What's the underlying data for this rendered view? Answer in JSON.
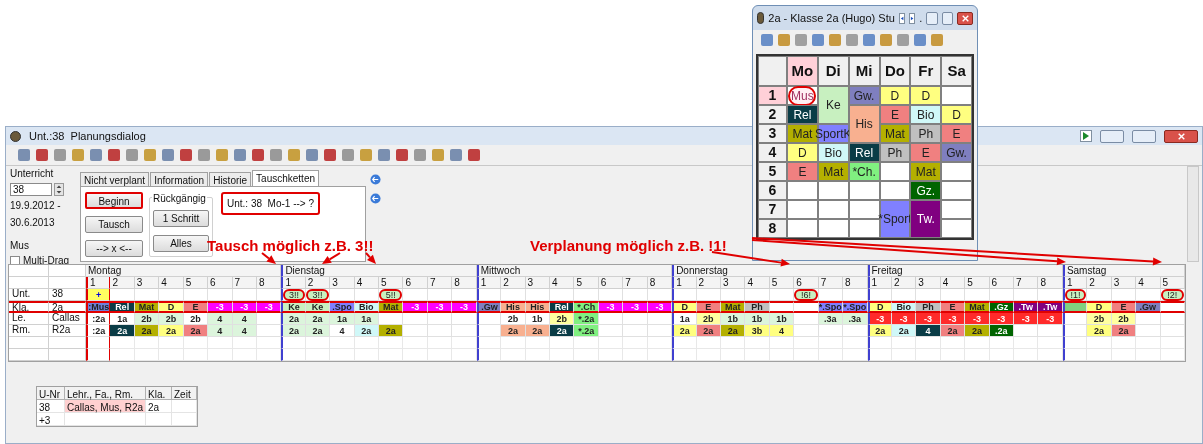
{
  "class_window": {
    "title": "2a - Klasse 2a (Hugo)  Stu",
    "title_tail": ".",
    "days": [
      {
        "label": "Mo",
        "selected": true
      },
      {
        "label": "Di",
        "selected": false
      },
      {
        "label": "Mi",
        "selected": false
      },
      {
        "label": "Do",
        "selected": false
      },
      {
        "label": "Fr",
        "selected": false
      },
      {
        "label": "Sa",
        "selected": false
      }
    ],
    "periods": [
      {
        "label": "1",
        "selected": true
      },
      {
        "label": "2",
        "selected": false
      },
      {
        "label": "3",
        "selected": false
      },
      {
        "label": "4",
        "selected": false
      },
      {
        "label": "5",
        "selected": false
      },
      {
        "label": "6",
        "selected": false
      },
      {
        "label": "7",
        "selected": false
      },
      {
        "label": "8",
        "selected": false
      }
    ],
    "columns": [
      [
        {
          "text": "Mus",
          "color": "#fff0f4",
          "circled": true
        },
        {
          "text": "Rel",
          "color": "#0a3c46"
        },
        {
          "text": "Mat",
          "color": "#b4b000"
        },
        {
          "text": "D",
          "color": "#ffff80"
        },
        {
          "text": "E",
          "color": "#f08080"
        },
        null,
        null,
        null
      ],
      [
        {
          "text": "Ke",
          "color": "#c8f0c0"
        },
        {
          "continued": true
        },
        {
          "text": "SportK",
          "color": "#8080ff"
        },
        {
          "text": "Bio",
          "color": "#d0f8f8"
        },
        {
          "text": "Mat",
          "color": "#b4b000"
        },
        null,
        null,
        null
      ],
      [
        {
          "text": "Gw.",
          "color": "#7f7fbf"
        },
        {
          "text": "His",
          "color": "#f8b090"
        },
        {
          "continued": true
        },
        {
          "text": "Rel",
          "color": "#0a3c46"
        },
        {
          "text": "*Ch.",
          "color": "#80f080"
        },
        null,
        null,
        null
      ],
      [
        {
          "text": "D",
          "color": "#ffff80"
        },
        {
          "text": "E",
          "color": "#f08080"
        },
        {
          "text": "Mat",
          "color": "#b4b000"
        },
        {
          "text": "Ph",
          "color": "#c0c0c0"
        },
        null,
        null,
        {
          "text": "*Sport",
          "color": "#8080ff"
        },
        {
          "continued": true
        }
      ],
      [
        {
          "text": "D",
          "color": "#ffff80"
        },
        {
          "text": "Bio",
          "color": "#d0f8f8"
        },
        {
          "text": "Ph",
          "color": "#c0c0c0"
        },
        {
          "text": "E",
          "color": "#f08080"
        },
        {
          "text": "Mat",
          "color": "#b4b000"
        },
        {
          "text": "Gz.",
          "color": "#006400"
        },
        {
          "text": "Tw.",
          "color": "#800080"
        },
        {
          "continued": true
        }
      ],
      [
        null,
        {
          "text": "D",
          "color": "#ffff80"
        },
        {
          "text": "E",
          "color": "#f08080"
        },
        {
          "text": "Gw.",
          "color": "#7f7fbf"
        },
        null,
        null,
        null,
        null
      ]
    ]
  },
  "window": {
    "title": "Unt.:38  Planungsdialog"
  },
  "left_panel": {
    "label": "Unterricht",
    "lesson_number": "38",
    "date_from": "19.9.2012 -",
    "date_to": "30.6.2013",
    "subject": "Mus",
    "multi_drag": {
      "label": "Multi-Drag",
      "checked": false
    }
  },
  "tabs": [
    {
      "label": "Nicht verplant",
      "selected": false
    },
    {
      "label": "Information",
      "selected": false
    },
    {
      "label": "Historie",
      "selected": false
    },
    {
      "label": "Tauschketten",
      "selected": true
    }
  ],
  "buttons": [
    {
      "label": "Beginn",
      "highlighted": true
    },
    {
      "label": "Tausch",
      "highlighted": false
    },
    {
      "label": "--> x <--",
      "highlighted": false
    }
  ],
  "undo_group": {
    "title": "Rückgängig",
    "buttons": [
      "1 Schritt",
      "Alles"
    ]
  },
  "chain_text": {
    "text": "Unt.: 38  Mo-1 --> ?",
    "highlighted": true
  },
  "annotations": [
    {
      "text": "Tausch möglich z.B. 3!!"
    },
    {
      "text": "Verplanung möglich z.B. !1!"
    }
  ],
  "plan": {
    "days": [
      {
        "name": "Montag",
        "periods": [
          {
            "label": "1",
            "selected": true
          },
          {
            "label": "2",
            "selected": false
          },
          {
            "label": "3",
            "selected": false
          },
          {
            "label": "4",
            "selected": false
          },
          {
            "label": "5",
            "selected": false
          },
          {
            "label": "6",
            "selected": false
          },
          {
            "label": "7",
            "selected": false
          },
          {
            "label": "8",
            "selected": false
          }
        ]
      },
      {
        "name": "Dienstag",
        "periods": [
          {
            "label": "1",
            "selected": false
          },
          {
            "label": "2",
            "selected": false
          },
          {
            "label": "3",
            "selected": false
          },
          {
            "label": "4",
            "selected": false
          },
          {
            "label": "5",
            "selected": false
          },
          {
            "label": "6",
            "selected": false
          },
          {
            "label": "7",
            "selected": false
          },
          {
            "label": "8",
            "selected": false
          }
        ]
      },
      {
        "name": "Mittwoch",
        "periods": [
          {
            "label": "1",
            "selected": false
          },
          {
            "label": "2",
            "selected": false
          },
          {
            "label": "3",
            "selected": false
          },
          {
            "label": "4",
            "selected": false
          },
          {
            "label": "5",
            "selected": false
          },
          {
            "label": "6",
            "selected": false
          },
          {
            "label": "7",
            "selected": false
          },
          {
            "label": "8",
            "selected": false
          }
        ]
      },
      {
        "name": "Donnerstag",
        "periods": [
          {
            "label": "1",
            "selected": false
          },
          {
            "label": "2",
            "selected": false
          },
          {
            "label": "3",
            "selected": false
          },
          {
            "label": "4",
            "selected": false
          },
          {
            "label": "5",
            "selected": false
          },
          {
            "label": "6",
            "selected": false
          },
          {
            "label": "7",
            "selected": false
          },
          {
            "label": "8",
            "selected": false
          }
        ]
      },
      {
        "name": "Freitag",
        "periods": [
          {
            "label": "1",
            "selected": false
          },
          {
            "label": "2",
            "selected": false
          },
          {
            "label": "3",
            "selected": false
          },
          {
            "label": "4",
            "selected": false
          },
          {
            "label": "5",
            "selected": false
          },
          {
            "label": "6",
            "selected": false
          },
          {
            "label": "7",
            "selected": false
          },
          {
            "label": "8",
            "selected": false
          }
        ]
      },
      {
        "name": "Samstag",
        "periods": [
          {
            "label": "1",
            "selected": false
          },
          {
            "label": "2",
            "selected": false
          },
          {
            "label": "3",
            "selected": false
          },
          {
            "label": "4",
            "selected": false
          },
          {
            "label": "5",
            "selected": false
          }
        ]
      }
    ],
    "rows": [
      {
        "head": "Unt.",
        "value": "38",
        "highlighted": false,
        "cells": [
          [
            {
              "text": "+",
              "color": "#ffff60",
              "circled": false
            },
            null,
            null,
            null,
            null,
            null,
            null,
            null
          ],
          [
            {
              "text": "3!!",
              "color": "#c8f0c0",
              "circled": true
            },
            {
              "text": "3!!",
              "color": "#c8f0c0",
              "circled": true
            },
            null,
            null,
            {
              "text": "5!!",
              "color": "#c8f0c0",
              "circled": true
            },
            null,
            null,
            null
          ],
          [
            null,
            null,
            null,
            null,
            null,
            null,
            null,
            null
          ],
          [
            null,
            null,
            null,
            null,
            null,
            {
              "text": "!6!",
              "color": "#c8f0c0",
              "circled": true
            },
            null,
            null
          ],
          [
            null,
            null,
            null,
            null,
            null,
            null,
            null,
            null
          ],
          [
            {
              "text": "!1!",
              "color": "#c8f0c0",
              "circled": true
            },
            null,
            null,
            null,
            {
              "text": "!2!",
              "color": "#c8f0c0",
              "circled": true
            }
          ]
        ]
      },
      {
        "head": "Kla.",
        "value": "2a",
        "highlighted": true,
        "cells": [
          [
            {
              "text": ":Mus",
              "color": "#6f80d8"
            },
            {
              "text": "Rel",
              "color": "#0a3c46"
            },
            {
              "text": "Mat",
              "color": "#b4b000"
            },
            {
              "text": "D",
              "color": "#ffff80"
            },
            {
              "text": "E",
              "color": "#f08080"
            },
            {
              "text": "-3",
              "color": "#ff00ff"
            },
            {
              "text": "-3",
              "color": "#ff00ff"
            },
            {
              "text": "-3",
              "color": "#ff00ff"
            }
          ],
          [
            {
              "text": "Ke",
              "color": "#c8f0c0"
            },
            {
              "text": "Ke",
              "color": "#c8f0c0"
            },
            {
              "text": ".Spo",
              "color": "#8080ff"
            },
            {
              "text": "Bio",
              "color": "#d0f8f8"
            },
            {
              "text": "Mat",
              "color": "#b4b000"
            },
            {
              "text": "-3",
              "color": "#ff00ff"
            },
            {
              "text": "-3",
              "color": "#ff00ff"
            },
            {
              "text": "-3",
              "color": "#ff00ff"
            }
          ],
          [
            {
              "text": ".Gw",
              "color": "#7f7fbf"
            },
            {
              "text": "His",
              "color": "#f8b090"
            },
            {
              "text": "His",
              "color": "#f8b090"
            },
            {
              "text": "Rel",
              "color": "#0a3c46"
            },
            {
              "text": "*.Ch",
              "color": "#80f080"
            },
            {
              "text": "-3",
              "color": "#ff00ff"
            },
            {
              "text": "-3",
              "color": "#ff00ff"
            },
            {
              "text": "-3",
              "color": "#ff00ff"
            }
          ],
          [
            {
              "text": "D",
              "color": "#ffff80"
            },
            {
              "text": "E",
              "color": "#f08080"
            },
            {
              "text": "Mat",
              "color": "#b4b000"
            },
            {
              "text": "Ph",
              "color": "#c0c0c0"
            },
            null,
            null,
            {
              "text": "*.Spo",
              "color": "#8080ff"
            },
            {
              "text": "*.Spo",
              "color": "#8080ff"
            }
          ],
          [
            {
              "text": "D",
              "color": "#ffff80"
            },
            {
              "text": "Bio",
              "color": "#d0f8f8"
            },
            {
              "text": "Ph",
              "color": "#c0c0c0"
            },
            {
              "text": "E",
              "color": "#f08080"
            },
            {
              "text": "Mat",
              "color": "#b4b000"
            },
            {
              "text": ".Gz",
              "color": "#006400"
            },
            {
              "text": ".Tw",
              "color": "#800080"
            },
            {
              "text": ".Tw",
              "color": "#800080"
            }
          ],
          [
            {
              "color": "#80d080"
            },
            {
              "text": "D",
              "color": "#ffff80"
            },
            {
              "text": "E",
              "color": "#f08080"
            },
            {
              "text": ".Gw",
              "color": "#7f7fbf"
            },
            null
          ]
        ]
      },
      {
        "head": "Le.",
        "value": "Callas",
        "highlighted": false,
        "cells": [
          [
            {
              "text": ":2a",
              "color": "#ffffff"
            },
            {
              "text": "1a",
              "color": "#ffffff"
            },
            {
              "text": "2b",
              "color": "#dcf5dc"
            },
            {
              "text": "2b",
              "color": "#dcf5dc"
            },
            {
              "text": "2b",
              "color": "#ffffff"
            },
            {
              "text": "4",
              "color": "#dcf5dc"
            },
            {
              "text": "4",
              "color": "#dcf5dc"
            },
            null
          ],
          [
            {
              "text": "2a",
              "color": "#dcf5dc"
            },
            {
              "text": "2a",
              "color": "#dcf5dc"
            },
            {
              "text": "1a",
              "color": "#dcf5dc"
            },
            {
              "text": "1a",
              "color": "#dcf5dc"
            },
            null,
            null,
            null,
            null
          ],
          [
            null,
            {
              "text": "2b",
              "color": "#ffffff"
            },
            {
              "text": "1b",
              "color": "#ffffff"
            },
            {
              "text": "2b",
              "color": "#ffffa0"
            },
            {
              "text": "*.2a",
              "color": "#80f080"
            },
            null,
            null,
            null
          ],
          [
            {
              "text": "1a",
              "color": "#ffffff"
            },
            {
              "text": "2b",
              "color": "#ffffa0"
            },
            {
              "text": "1b",
              "color": "#dcf5dc"
            },
            {
              "text": "1b",
              "color": "#dcf5dc"
            },
            {
              "text": "1b",
              "color": "#dcf5dc"
            },
            null,
            {
              "text": ".3a",
              "color": "#dcf5dc"
            },
            {
              "text": ".3a",
              "color": "#dcf5dc"
            }
          ],
          [
            {
              "text": "-3",
              "color": "#ff2a2a"
            },
            {
              "text": "-3",
              "color": "#ff2a2a"
            },
            {
              "text": "-3",
              "color": "#ff2a2a"
            },
            {
              "text": "-3",
              "color": "#ff2a2a"
            },
            {
              "text": "-3",
              "color": "#ff2a2a"
            },
            {
              "text": "-3",
              "color": "#ff2a2a"
            },
            {
              "text": "-3",
              "color": "#ff2a2a"
            },
            {
              "text": "-3",
              "color": "#ff2a2a"
            }
          ],
          [
            null,
            {
              "text": "2b",
              "color": "#ffffa0"
            },
            {
              "text": "2b",
              "color": "#ffffa0"
            },
            null,
            null
          ]
        ]
      },
      {
        "head": "Rm.",
        "value": "R2a",
        "highlighted": false,
        "cells": [
          [
            {
              "text": ":2a",
              "color": "#ffffff"
            },
            {
              "text": "2a",
              "color": "#0a3c46"
            },
            {
              "text": "2a",
              "color": "#b4b000"
            },
            {
              "text": "2a",
              "color": "#ffff80"
            },
            {
              "text": "2a",
              "color": "#f08080"
            },
            {
              "text": "4",
              "color": "#dcf5dc"
            },
            {
              "text": "4",
              "color": "#dcf5dc"
            },
            null
          ],
          [
            {
              "text": "2a",
              "color": "#dcf5dc"
            },
            {
              "text": "2a",
              "color": "#dcf5dc"
            },
            {
              "text": "4",
              "color": "#ffffff"
            },
            {
              "text": "2a",
              "color": "#d0f8f8"
            },
            {
              "text": "2a",
              "color": "#b4b000"
            },
            null,
            null,
            null
          ],
          [
            null,
            {
              "text": "2a",
              "color": "#f8b090"
            },
            {
              "text": "2a",
              "color": "#f8b090"
            },
            {
              "text": "2a",
              "color": "#0a3c46"
            },
            {
              "text": "*.2a",
              "color": "#80f080"
            },
            null,
            null,
            null
          ],
          [
            {
              "text": "2a",
              "color": "#ffff80"
            },
            {
              "text": "2a",
              "color": "#f08080"
            },
            {
              "text": "2a",
              "color": "#b4b000"
            },
            {
              "text": "3b",
              "color": "#ffff80"
            },
            {
              "text": "4",
              "color": "#ffff80"
            },
            null,
            null,
            null
          ],
          [
            {
              "text": "2a",
              "color": "#ffff80"
            },
            {
              "text": "2a",
              "color": "#d0f8f8"
            },
            {
              "text": "4",
              "color": "#0a3c46"
            },
            {
              "text": "2a",
              "color": "#f08080"
            },
            {
              "text": "2a",
              "color": "#b4b000"
            },
            {
              "text": ".2a",
              "color": "#006400"
            },
            null,
            null
          ],
          [
            null,
            {
              "text": "2a",
              "color": "#ffff80"
            },
            {
              "text": "2a",
              "color": "#f08080"
            },
            null,
            null
          ]
        ]
      }
    ]
  },
  "lesson_table": {
    "columns": [
      "U-Nr",
      "Lehr., Fa., Rm.",
      "Kla.",
      "Zeit"
    ],
    "rows": [
      {
        "cells": [
          "38",
          "Callas, Mus, R2a",
          "2a"
        ],
        "selected": true
      },
      {
        "cells": [
          "+3"
        ],
        "selected": false
      }
    ]
  }
}
